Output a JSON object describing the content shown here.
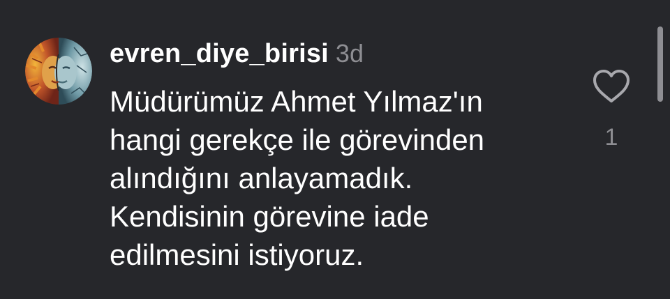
{
  "comment": {
    "username": "evren_diye_birisi",
    "timestamp": "3d",
    "text_lines": [
      "Müdürümüz Ahmet Yılmaz'ın",
      "hangi gerekçe ile görevinden",
      "alındığını anlayamadık.",
      "Kendisinin görevine iade",
      "edilmesini istiyoruz."
    ],
    "like_count": "1",
    "like_icon": "heart-outline-icon",
    "avatar_icon": "sun-moon-face-avatar"
  },
  "colors": {
    "background": "#26272b",
    "primary_text": "#ffffff",
    "secondary_text": "#8e8e93",
    "icon": "#a8a8ad"
  }
}
